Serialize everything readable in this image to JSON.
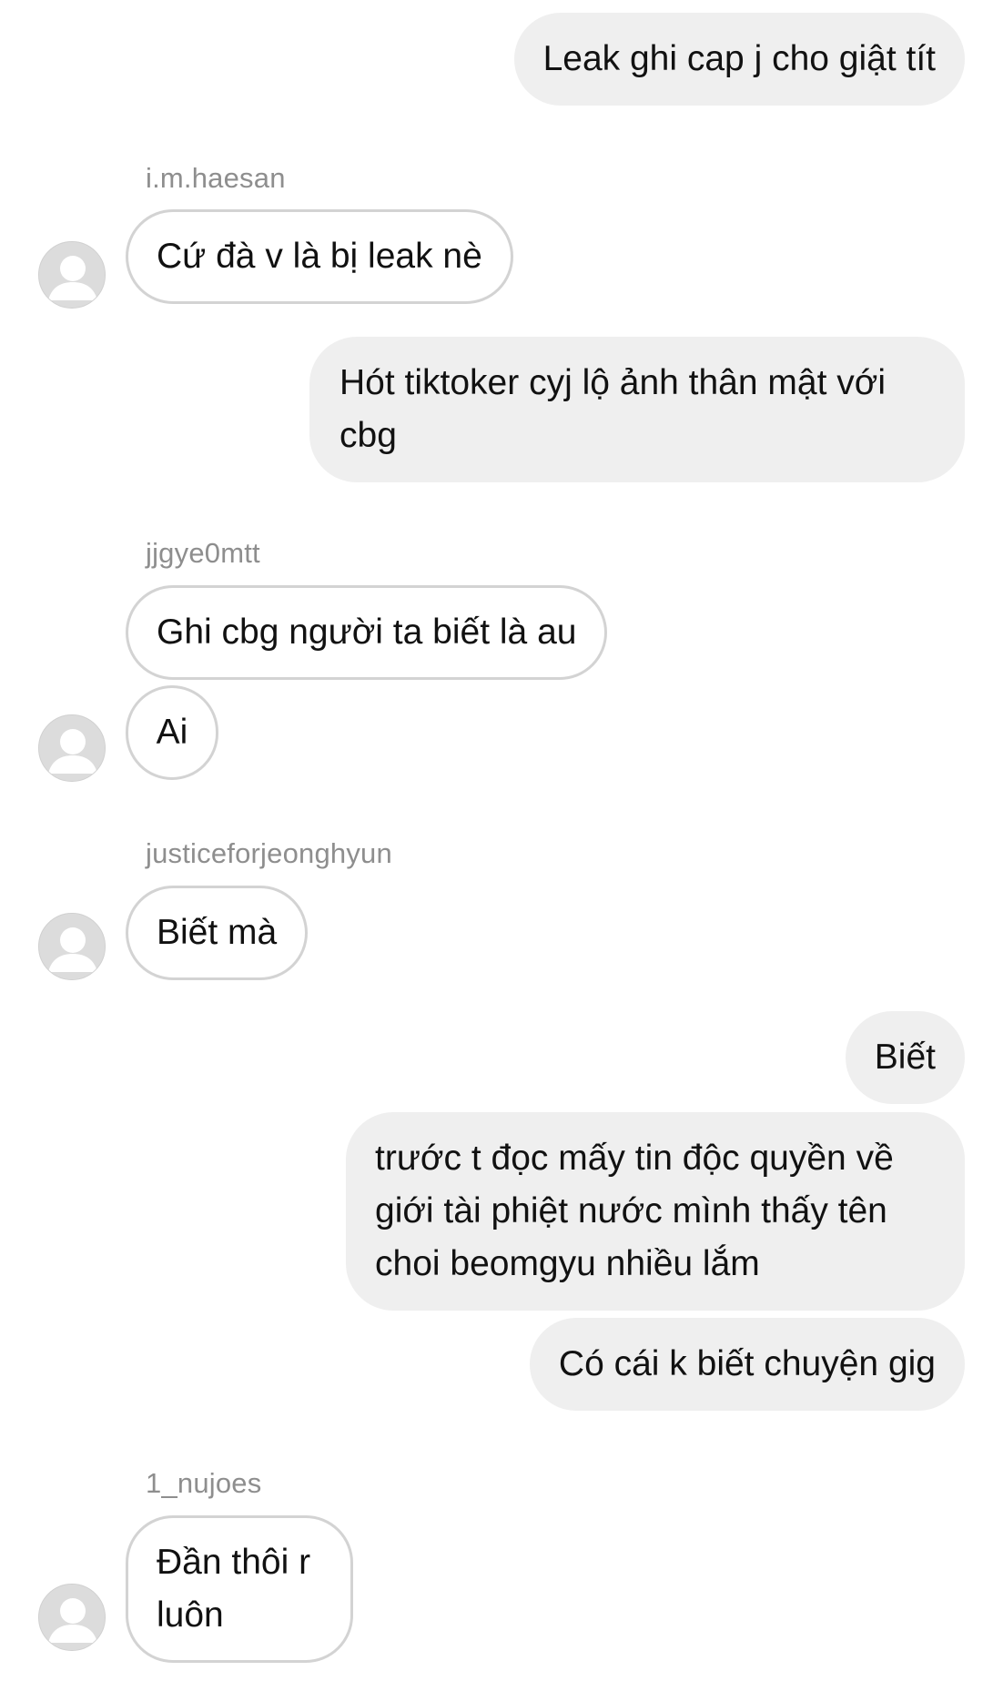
{
  "messages": [
    {
      "id": "m1",
      "direction": "outgoing",
      "lines": [
        "Leak ghi cap j cho giật tít"
      ]
    },
    {
      "id": "m2",
      "direction": "incoming",
      "sender": "i.m.haesan",
      "lines": [
        "Cứ đà v là bị leak nè"
      ]
    },
    {
      "id": "m3",
      "direction": "outgoing",
      "lines": [
        "Hót tiktoker cyj lộ ảnh thân mật với",
        "cbg"
      ]
    },
    {
      "id": "m4",
      "direction": "incoming",
      "sender": "jjgye0mtt",
      "lines": [
        "Ghi cbg người ta biết là au"
      ]
    },
    {
      "id": "m5",
      "direction": "incoming",
      "lines": [
        "Ai"
      ]
    },
    {
      "id": "m6",
      "direction": "incoming",
      "sender": "justiceforjeonghyun",
      "lines": [
        "Biết mà"
      ]
    },
    {
      "id": "m7",
      "direction": "outgoing",
      "lines": [
        "Biết"
      ]
    },
    {
      "id": "m8",
      "direction": "outgoing",
      "lines": [
        "trước t đọc mấy tin độc quyền về",
        "giới tài phiệt nước mình thấy tên",
        "choi beomgyu nhiều lắm"
      ]
    },
    {
      "id": "m9",
      "direction": "outgoing",
      "lines": [
        "Có cái k biết chuyện gig"
      ]
    },
    {
      "id": "m10",
      "direction": "incoming",
      "sender": "1_nujoes",
      "lines": [
        "Đần thôi r",
        "luôn"
      ]
    }
  ],
  "icons": {
    "avatar": "default-avatar-icon"
  },
  "colors": {
    "outgoing_bubble": "#efefef",
    "incoming_border": "#d3d3d3",
    "sender_text": "#8e8e8e",
    "avatar": "#dcdcdc"
  }
}
